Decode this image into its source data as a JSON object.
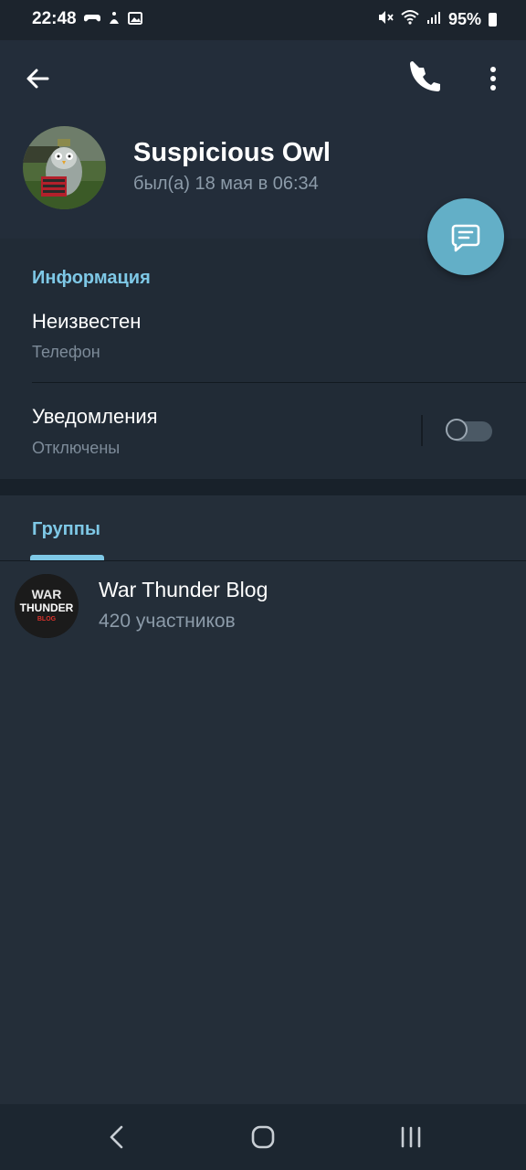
{
  "status_bar": {
    "time": "22:48",
    "battery": "95%",
    "icons": [
      "gamepad-icon",
      "accessibility-icon",
      "image-icon",
      "mute-icon",
      "wifi-icon",
      "signal-icon",
      "battery-icon"
    ]
  },
  "header": {
    "name": "Suspicious Owl",
    "last_seen": "был(а) 18 мая в 06:34"
  },
  "info": {
    "title": "Информация",
    "phone_value": "Неизвестен",
    "phone_label": "Телефон",
    "notifications_label": "Уведомления",
    "notifications_value": "Отключены",
    "notifications_enabled": false
  },
  "groups": {
    "tab_label": "Группы",
    "items": [
      {
        "name": "War Thunder Blog",
        "members": "420 участников",
        "logo_text_top": "WAR",
        "logo_text_mid": "THUNDER",
        "logo_text_bottom": "BLOG"
      }
    ]
  },
  "colors": {
    "accent": "#7ec8e6",
    "fab": "#63afc7",
    "background": "#1d2733",
    "header": "#232d3a"
  }
}
